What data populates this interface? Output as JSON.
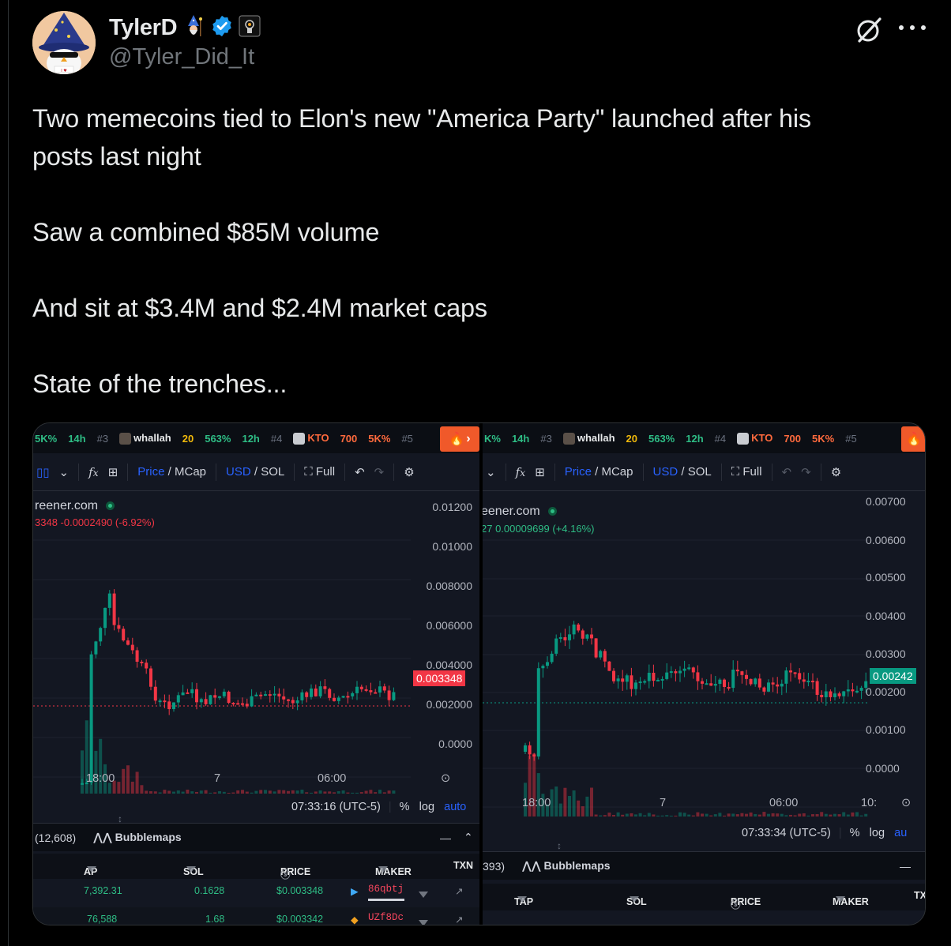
{
  "tweet": {
    "display_name": "TylerD",
    "handle": "@Tyler_Did_It",
    "paragraphs": [
      "Two memecoins tied to Elon's new \"America Party\" launched after his",
      "posts last night",
      "Saw a combined $85M volume",
      "And sit at $3.4M and $2.4M market caps",
      "State of the trenches..."
    ],
    "icons": [
      "wizard-emoji",
      "verified-badge-icon",
      "affiliate-badge-icon",
      "grok-icon",
      "more-icon"
    ]
  },
  "left_chart": {
    "topbar": {
      "items": [
        {
          "label": "5K%",
          "class": "green"
        },
        {
          "label": "14h",
          "class": "green"
        },
        {
          "label": "#3",
          "class": "rank"
        },
        {
          "label": "whallah",
          "class": "name"
        },
        {
          "label": "20",
          "class": "yellow"
        },
        {
          "label": "563%",
          "class": "green"
        },
        {
          "label": "12h",
          "class": "green"
        },
        {
          "label": "#4",
          "class": "rank"
        },
        {
          "label": "KTO",
          "class": "orange"
        },
        {
          "label": "700",
          "class": "orange"
        },
        {
          "label": "5K%",
          "class": "orange"
        },
        {
          "label": "#5",
          "class": "rank"
        }
      ]
    },
    "toolbar": {
      "price": "Price",
      "mcap": "MCap",
      "usd": "USD",
      "sol": "SOL",
      "full": "Full"
    },
    "site": "reener.com",
    "price_change": "3348  -0.0002490 (-6.92%)",
    "y_labels": [
      "0.01200",
      "0.01000",
      "0.008000",
      "0.006000",
      "0.004000",
      "0.002000",
      "0.0000"
    ],
    "current_price": "0.003348",
    "x_labels": [
      "18:00",
      "7",
      "06:00"
    ],
    "time": "07:33:16 (UTC-5)",
    "scale": {
      "pct": "%",
      "log": "log",
      "auto": "auto"
    },
    "bottom": {
      "count": "(12,608)",
      "bubblemaps": "Bubblemaps"
    },
    "table_headers": [
      "AP",
      "SOL",
      "PRICE",
      "MAKER",
      "TXN"
    ],
    "rows": [
      {
        "ap": "7,392.31",
        "sol": "0.1628",
        "price": "$0.003348",
        "maker": "86qbtj"
      },
      {
        "ap": "76,588",
        "sol": "1.68",
        "price": "$0.003342",
        "maker": "UZf8Dc"
      }
    ],
    "colors": {
      "up": "#089981",
      "down": "#f23645",
      "tag": "#f23645"
    }
  },
  "right_chart": {
    "topbar": {
      "items": [
        {
          "label": "K%",
          "class": "green"
        },
        {
          "label": "14h",
          "class": "green"
        },
        {
          "label": "#3",
          "class": "rank"
        },
        {
          "label": "whallah",
          "class": "name"
        },
        {
          "label": "20",
          "class": "yellow"
        },
        {
          "label": "563%",
          "class": "green"
        },
        {
          "label": "12h",
          "class": "green"
        },
        {
          "label": "#4",
          "class": "rank"
        },
        {
          "label": "KTO",
          "class": "orange"
        },
        {
          "label": "700",
          "class": "orange"
        },
        {
          "label": "5K%",
          "class": "orange"
        },
        {
          "label": "#5",
          "class": "rank"
        }
      ]
    },
    "toolbar": {
      "price": "Price",
      "mcap": "MCap",
      "usd": "USD",
      "sol": "SOL",
      "full": "Full"
    },
    "site": "eener.com",
    "price_change": "27  0.00009699 (+4.16%)",
    "y_labels": [
      "0.00700",
      "0.00600",
      "0.00500",
      "0.00400",
      "0.00300",
      "0.00200",
      "0.00100",
      "0.0000"
    ],
    "current_price": "0.00242",
    "x_labels": [
      "18:00",
      "7",
      "06:00",
      "10:"
    ],
    "time": "07:33:34 (UTC-5)",
    "scale": {
      "pct": "%",
      "log": "log",
      "auto": "au"
    },
    "bottom": {
      "count": "393)",
      "bubblemaps": "Bubblemaps"
    },
    "table_headers": [
      "TAP",
      "SOL",
      "PRICE",
      "MAKER",
      "TX"
    ],
    "colors": {
      "up": "#089981",
      "down": "#f23645",
      "tag": "#089981"
    }
  }
}
